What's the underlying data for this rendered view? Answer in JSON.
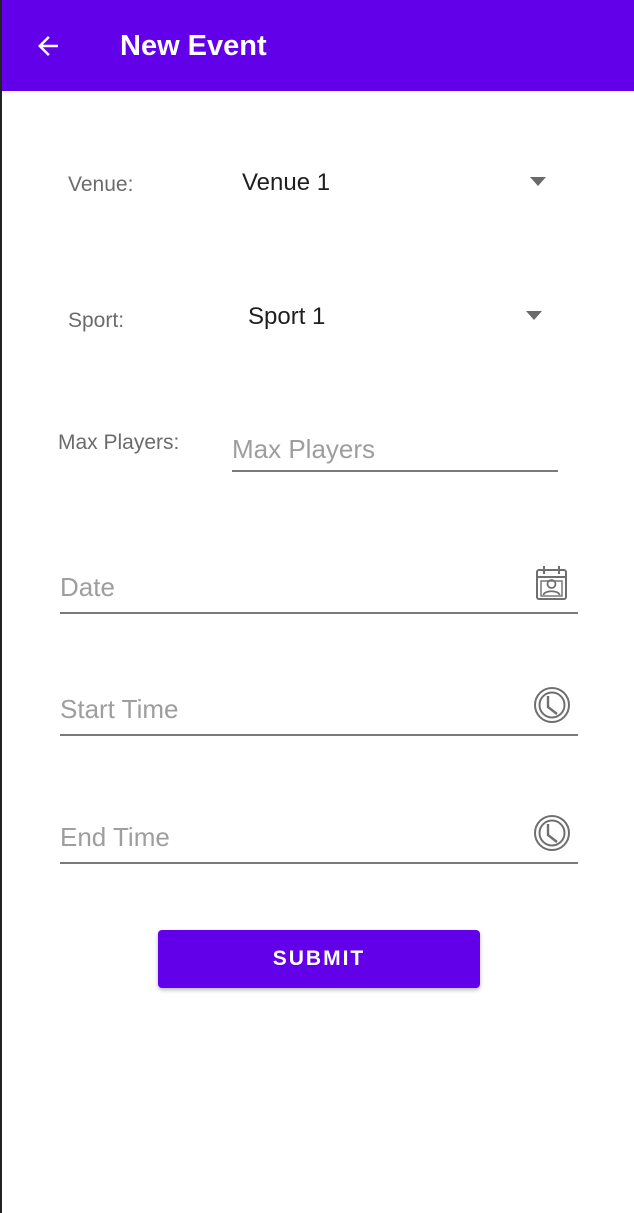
{
  "appbar": {
    "title": "New Event",
    "back_icon": "arrow-back-icon",
    "color": "#6200ea"
  },
  "form": {
    "venue": {
      "label": "Venue:",
      "selected": "Venue 1"
    },
    "sport": {
      "label": "Sport:",
      "selected": "Sport 1"
    },
    "max_players": {
      "label": "Max Players:",
      "placeholder": "Max Players",
      "value": ""
    },
    "date": {
      "placeholder": "Date",
      "value": "",
      "icon": "calendar-icon"
    },
    "start_time": {
      "placeholder": "Start Time",
      "value": "",
      "icon": "clock-icon"
    },
    "end_time": {
      "placeholder": "End Time",
      "value": "",
      "icon": "clock-icon"
    }
  },
  "submit": {
    "label": "SUBMIT"
  }
}
